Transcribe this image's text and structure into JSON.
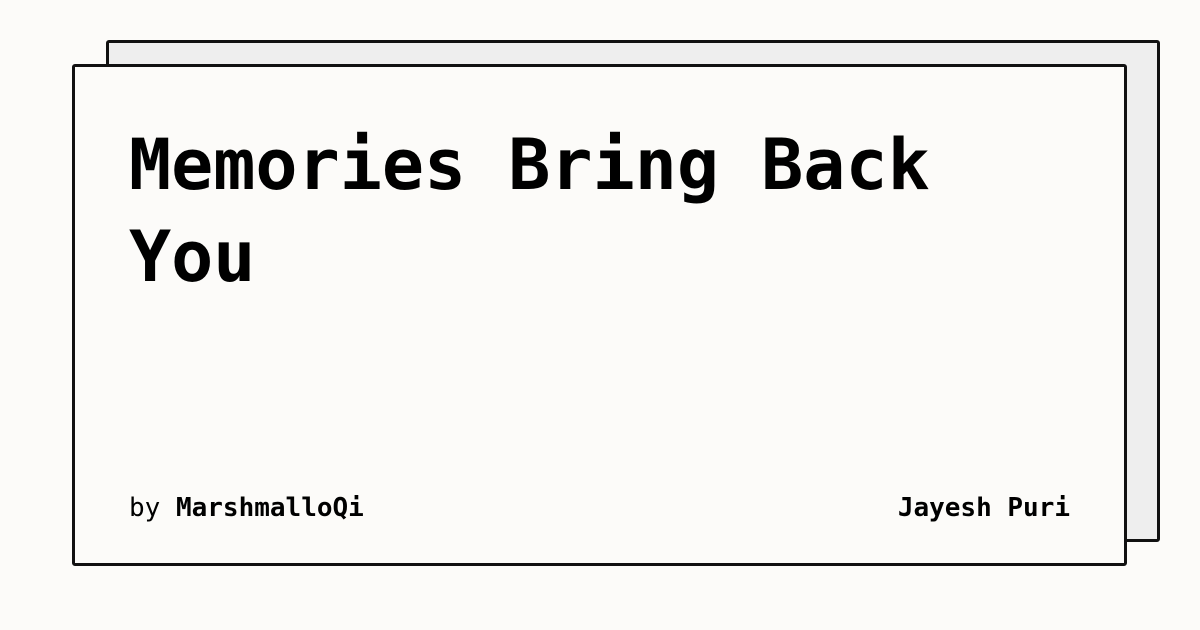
{
  "card": {
    "title": "Memories Bring Back You",
    "byline_prefix": "by",
    "author": "MarshmalloQi",
    "credit": "Jayesh Puri"
  }
}
